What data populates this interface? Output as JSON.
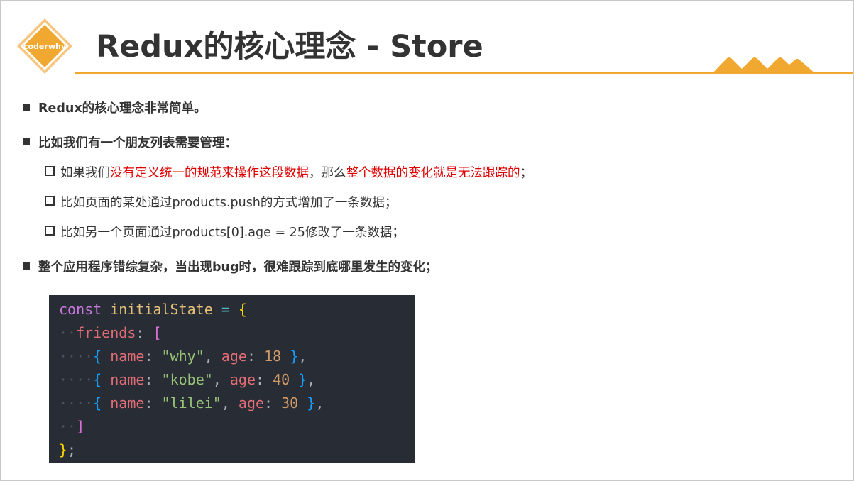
{
  "header": {
    "logo_text": "coderwhy",
    "title": "Redux的核心理念 - Store",
    "accent_color": "#f0a830"
  },
  "bullets": [
    {
      "level": 1,
      "text": "Redux的核心理念非常简单。"
    },
    {
      "level": 1,
      "text": "比如我们有一个朋友列表需要管理："
    },
    {
      "level": 2,
      "segments": [
        {
          "text": "如果我们",
          "red": false
        },
        {
          "text": "没有定义统一的规范来操作这段数据",
          "red": true
        },
        {
          "text": "，那么",
          "red": false
        },
        {
          "text": "整个数据的变化就是无法跟踪的",
          "red": true
        },
        {
          "text": "；",
          "red": false
        }
      ]
    },
    {
      "level": 2,
      "text": "比如页面的某处通过products.push的方式增加了一条数据；"
    },
    {
      "level": 2,
      "text": "比如另一个页面通过products[0].age = 25修改了一条数据；"
    },
    {
      "level": 1,
      "text": "整个应用程序错综复杂，当出现bug时，很难跟踪到底哪里发生的变化；"
    }
  ],
  "code": {
    "language": "javascript",
    "lines": [
      "const initialState = {",
      "  friends: [",
      "    { name: \"why\", age: 18 },",
      "    { name: \"kobe\", age: 40 },",
      "    { name: \"lilei\", age: 30 },",
      "  ]",
      "};"
    ],
    "tokens": {
      "keyword": "const",
      "identifier": "initialState",
      "equals": "=",
      "prop_friends": "friends",
      "prop_name": "name",
      "prop_age": "age",
      "friends": [
        {
          "name": "\"why\"",
          "age": "18"
        },
        {
          "name": "\"kobe\"",
          "age": "40"
        },
        {
          "name": "\"lilei\"",
          "age": "30"
        }
      ]
    },
    "background_color": "#282c34"
  }
}
